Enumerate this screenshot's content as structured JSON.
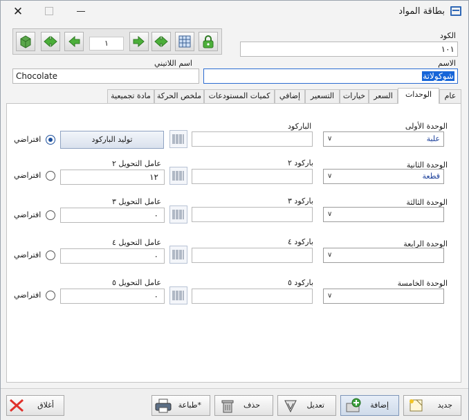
{
  "window": {
    "title": "بطاقة المواد",
    "close_glyph": "✕"
  },
  "navigator": {
    "record_number": "١"
  },
  "header": {
    "code_label": "الكود",
    "code_value": "١٠١",
    "name_label": "الاسم",
    "name_value": "شوكولاتة",
    "latin_name_label": "اسم اللاتيني",
    "latin_name_value": "Chocolate"
  },
  "tabs": [
    {
      "label": "عام"
    },
    {
      "label": "الوحدات"
    },
    {
      "label": "السعر"
    },
    {
      "label": "خيارات"
    },
    {
      "label": "التسعير"
    },
    {
      "label": "إضافي"
    },
    {
      "label": "كميات المستودعات"
    },
    {
      "label": "ملخص الحركة"
    },
    {
      "label": "مادة تجميعية"
    }
  ],
  "units": {
    "barcode_label": "الباركود",
    "generate_barcode_label": "توليد الباركود",
    "default_label": "افتراضي",
    "rows": [
      {
        "unit_label": "الوحدة الأولى",
        "unit_value": "علبة",
        "barcode_label": "الباركود",
        "conv_label": "",
        "conv_value": "",
        "is_default": true
      },
      {
        "unit_label": "الوحدة الثانية",
        "unit_value": "قطعة",
        "barcode_label": "باركود ٢",
        "conv_label": "عامل التحويل ٢",
        "conv_value": "١٢",
        "is_default": false
      },
      {
        "unit_label": "الوحدة الثالثة",
        "unit_value": "",
        "barcode_label": "باركود ٣",
        "conv_label": "عامل التحويل ٣",
        "conv_value": "٠",
        "is_default": false
      },
      {
        "unit_label": "الوحدة الرابعة",
        "unit_value": "",
        "barcode_label": "باركود ٤",
        "conv_label": "عامل التحويل ٤",
        "conv_value": "٠",
        "is_default": false
      },
      {
        "unit_label": "الوحدة الخامسة",
        "unit_value": "",
        "barcode_label": "باركود ٥",
        "conv_label": "عامل التحويل ٥",
        "conv_value": "٠",
        "is_default": false
      }
    ]
  },
  "footer": {
    "new_label": "جديد",
    "add_label": "إضافة",
    "edit_label": "تعديل",
    "delete_label": "حذف",
    "print_label": "طباعة*",
    "close_label": "أغلاق"
  },
  "colors": {
    "accent": "#2f67b5",
    "selection": "#1665d8",
    "combo_value": "#1b3f9a",
    "nav_green": "#4caf3a",
    "close_red": "#e0312b"
  }
}
